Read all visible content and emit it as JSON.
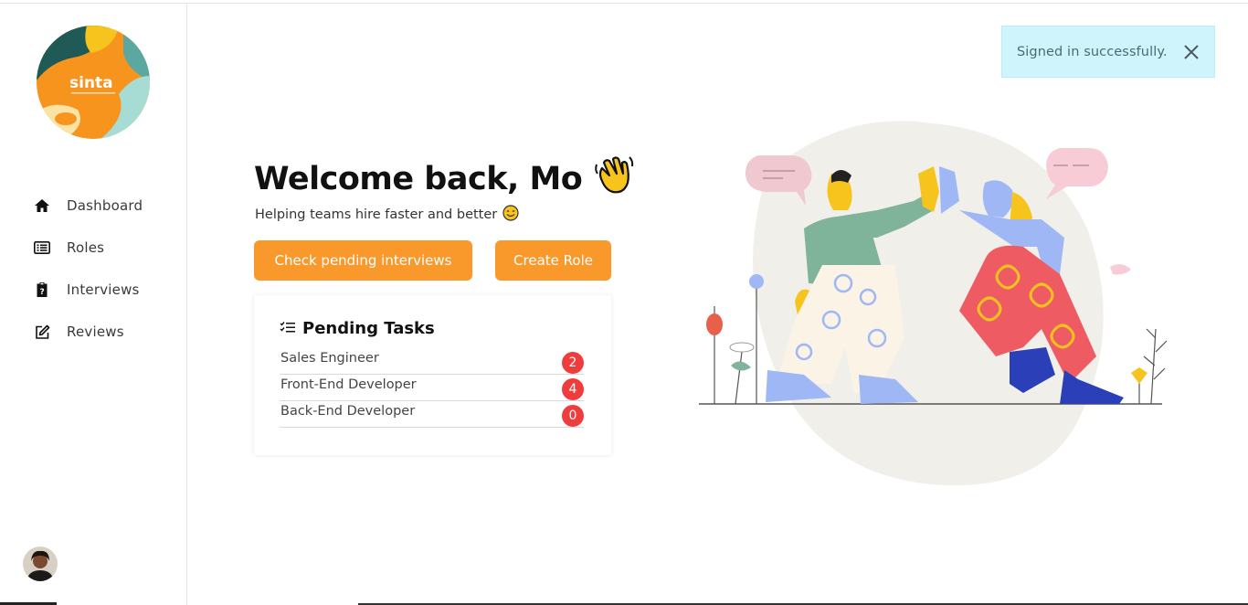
{
  "brand": {
    "logo_text": "sinta"
  },
  "sidebar": {
    "items": [
      {
        "label": "Dashboard",
        "icon": "home-icon"
      },
      {
        "label": "Roles",
        "icon": "list-icon"
      },
      {
        "label": "Interviews",
        "icon": "clipboard-icon"
      },
      {
        "label": "Reviews",
        "icon": "edit-icon"
      }
    ]
  },
  "toast": {
    "message": "Signed in successfully."
  },
  "main": {
    "title": "Welcome back, Mo",
    "subtitle": "Helping teams hire faster and better",
    "buttons": {
      "check_pending": "Check pending interviews",
      "create_role": "Create Role"
    }
  },
  "pending_tasks": {
    "title": "Pending Tasks",
    "items": [
      {
        "name": "Sales Engineer",
        "count": "2"
      },
      {
        "name": "Front-End Developer",
        "count": "4"
      },
      {
        "name": "Back-End Developer",
        "count": "0"
      }
    ]
  },
  "colors": {
    "accent": "#f9992b",
    "badge": "#ef3d3d",
    "toast_bg": "#cff4fc"
  }
}
